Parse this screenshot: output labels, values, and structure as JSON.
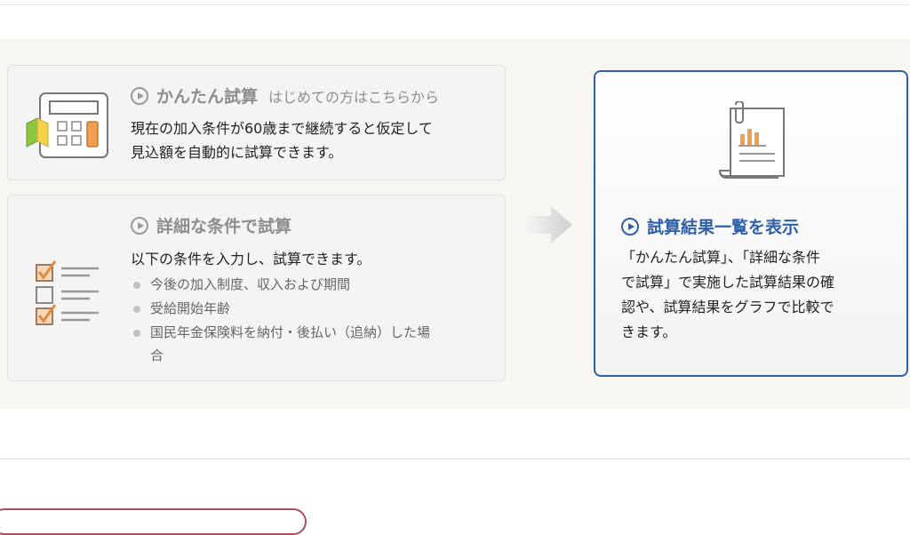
{
  "simple": {
    "title": "かんたん試算",
    "subtitle": "はじめての方はこちらから",
    "description_line1": "現在の加入条件が60歳まで継続すると仮定して",
    "description_line2": "見込額を自動的に試算できます。",
    "icon": "calculator-icon"
  },
  "detail": {
    "title": "詳細な条件で試算",
    "description": "以下の条件を入力し、試算できます。",
    "bullets": [
      "今後の加入制度、収入および期間",
      "受給開始年齢",
      "国民年金保険料を納付・後払い（追納）した場",
      "合"
    ],
    "icon": "checklist-icon"
  },
  "result": {
    "title": "試算結果一覧を表示",
    "description_lines": [
      "「かんたん試算」、「詳細な条件",
      "で試算」で実施した試算結果の確",
      "認や、試算結果をグラフで比較で",
      "きます。"
    ],
    "icon": "report-document-icon"
  },
  "colors": {
    "accent_blue": "#2f5fa8",
    "band_background": "#f8f6f1",
    "calculator_orange": "#f0a050"
  }
}
